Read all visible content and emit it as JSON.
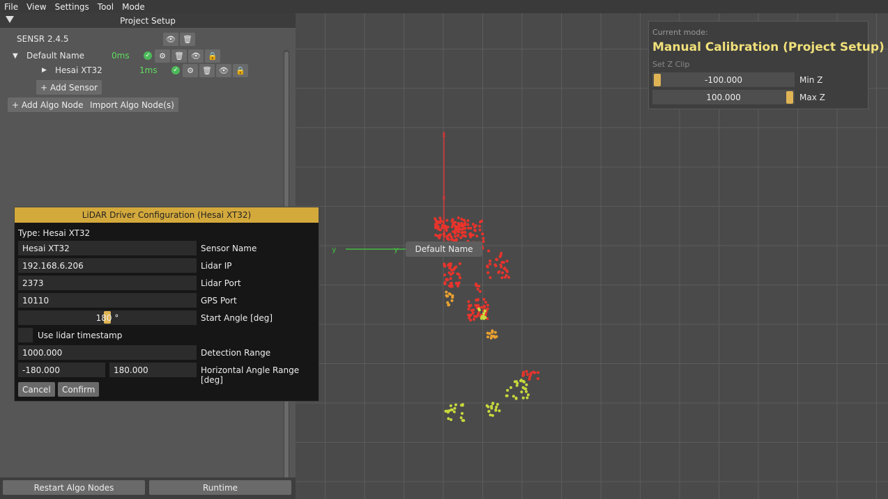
{
  "menu": [
    "File",
    "View",
    "Settings",
    "Tool",
    "Mode"
  ],
  "panel": {
    "title": "Project Setup",
    "version": "SENSR 2.4.5",
    "node": {
      "name": "Default Name",
      "ms": "0ms"
    },
    "sensor": {
      "name": "Hesai XT32",
      "ms": "1ms"
    },
    "add_sensor": "+ Add Sensor",
    "add_algo": "+ Add Algo Node",
    "import_algo": "Import Algo Node(s)",
    "restart": "Restart Algo Nodes",
    "runtime": "Runtime"
  },
  "dialog": {
    "title": "LiDAR Driver Configuration (Hesai XT32)",
    "type_label": "Type: Hesai XT32",
    "sensor_name": "Hesai XT32",
    "sensor_name_label": "Sensor Name",
    "lidar_ip": "192.168.6.206",
    "lidar_ip_label": "Lidar IP",
    "lidar_port": "2373",
    "lidar_port_label": "Lidar Port",
    "gps_port": "10110",
    "gps_port_label": "GPS Port",
    "start_angle": "180 °",
    "start_angle_label": "Start Angle [deg]",
    "timestamp_label": "Use lidar timestamp",
    "detection_range": "1000.000",
    "detection_range_label": "Detection Range",
    "h_min": "-180.000",
    "h_max": "180.000",
    "h_label": "Horizontal Angle Range [deg]",
    "cancel": "Cancel",
    "confirm": "Confirm"
  },
  "clip": {
    "mode_label": "Current mode:",
    "mode": "Manual Calibration (Project Setup)",
    "set_z": "Set Z Clip",
    "min_z": "-100.000",
    "min_label": "Min Z",
    "max_z": "100.000",
    "max_label": "Max Z"
  },
  "viewport": {
    "node_label": "Default Name",
    "axis_y": "y"
  },
  "colors": {
    "accent": "#d4a93c",
    "mode_text": "#f0e07a",
    "points_red": "#e8342c",
    "points_yellow": "#c8d83c"
  }
}
